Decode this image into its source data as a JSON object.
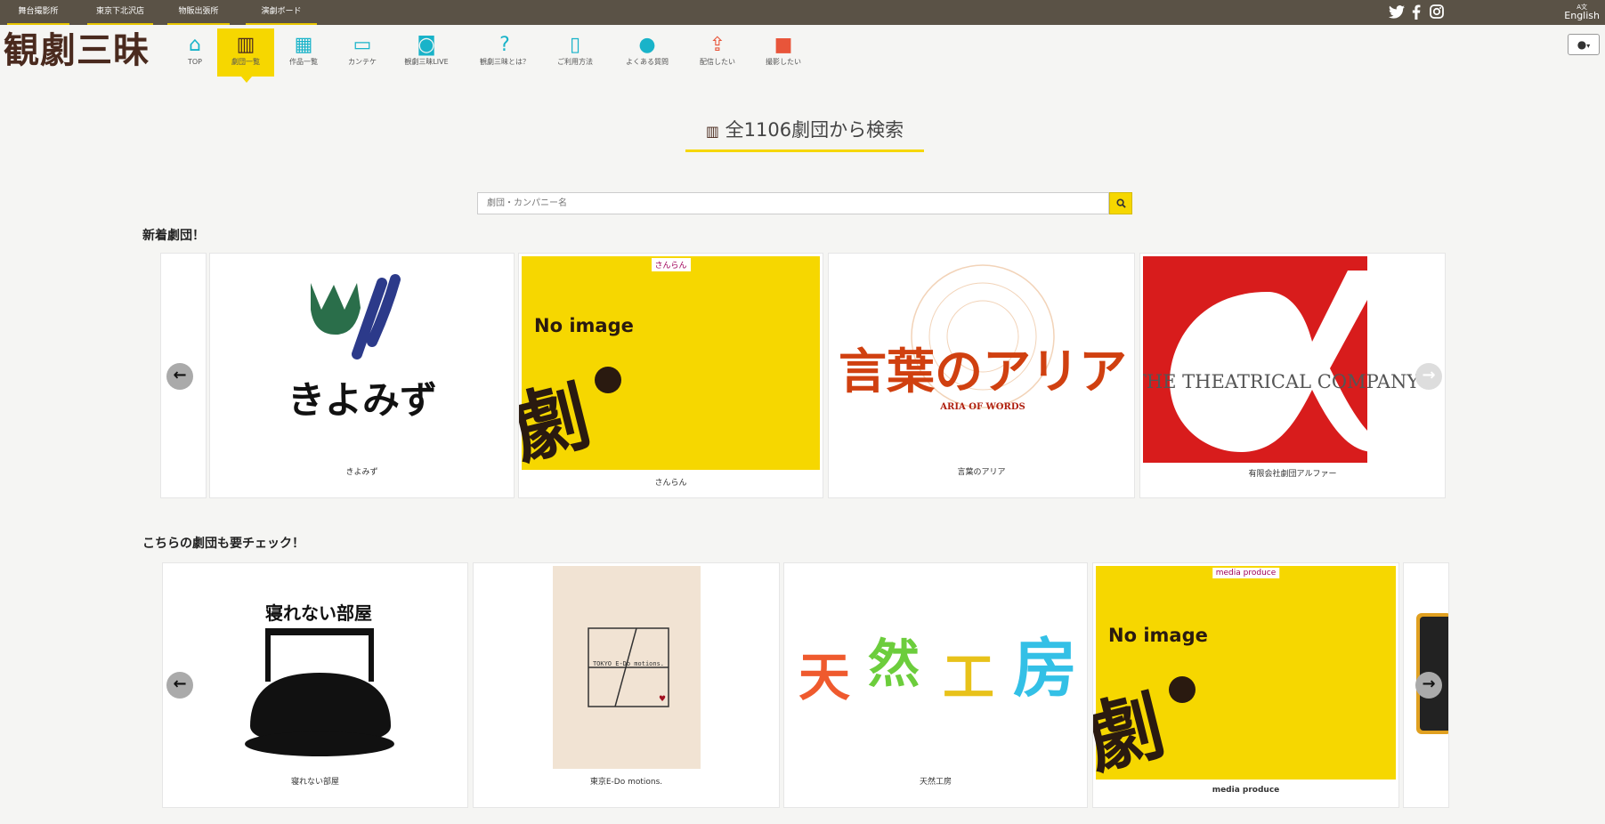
{
  "topbar": {
    "links": [
      "舞台撮影所",
      "東京下北沢店",
      "物販出張所",
      "演劇ボード"
    ],
    "social": {
      "twitter": "twitter-icon",
      "facebook": "facebook-icon",
      "instagram": "instagram-icon"
    },
    "english_label": "English"
  },
  "logo": "観劇三昧",
  "nav": [
    {
      "label": "TOP",
      "icon": "home-icon",
      "glyph": "⌂",
      "color": "#19b3c9"
    },
    {
      "label": "劇団一覧",
      "icon": "building-icon",
      "glyph": "▥",
      "color": "#4a2a1e"
    },
    {
      "label": "作品一覧",
      "icon": "film-icon",
      "glyph": "▦",
      "color": "#19b3c9"
    },
    {
      "label": "カンテケ",
      "icon": "ticket-icon",
      "glyph": "▭",
      "color": "#19b3c9"
    },
    {
      "label": "観劇三昧LIVE",
      "icon": "live-icon",
      "glyph": "◙",
      "color": "#19b3c9"
    },
    {
      "label": "観劇三昧とは？",
      "icon": "question-icon",
      "glyph": "?",
      "color": "#19b3c9"
    },
    {
      "label": "ご利用方法",
      "icon": "smartphone-icon",
      "glyph": "▯",
      "color": "#19b3c9"
    },
    {
      "label": "よくある質問",
      "icon": "chat-icon",
      "glyph": "●",
      "color": "#19b3c9"
    },
    {
      "label": "配信したい",
      "icon": "upload-icon",
      "glyph": "⇪",
      "color": "#e8553a"
    },
    {
      "label": "撮影したい",
      "icon": "video-camera-icon",
      "glyph": "■",
      "color": "#e8553a"
    }
  ],
  "page_title": "全1106劇団から検索",
  "search": {
    "placeholder": "劇団・カンパニー名"
  },
  "sections": {
    "new": {
      "heading": "新着劇団！"
    },
    "check": {
      "heading": "こちらの劇団も要チェック！"
    }
  },
  "new_cards": [
    {
      "name": "きよみず",
      "logo_text": "きよみず"
    },
    {
      "name": "さんらん",
      "tag": "さんらん",
      "noimage": "No image"
    },
    {
      "name": "言葉のアリア",
      "logo_text": "言葉のアリア",
      "logo_sub": "ARIA OF WORDS"
    },
    {
      "name": "有限会社劇団アルファー",
      "logo_text": "THE THEATRICAL COMPANY"
    }
  ],
  "check_cards": [
    {
      "name": "寝れない部屋",
      "logo_text": "寝れない部屋"
    },
    {
      "name": "東京E-Do motions.",
      "logo_text": "TOKYO E-Do motions."
    },
    {
      "name": "天然工房",
      "logo_text": [
        "天",
        "然",
        "工",
        "房"
      ]
    },
    {
      "name": "media produce",
      "tag": "media produce",
      "noimage": "No image"
    }
  ],
  "noimage_kanji": "劇",
  "colors": {
    "accent": "#f6d700",
    "topbar": "#5a5246",
    "teal": "#19b3c9",
    "red": "#e8553a",
    "logo": "#4a2a1e"
  }
}
